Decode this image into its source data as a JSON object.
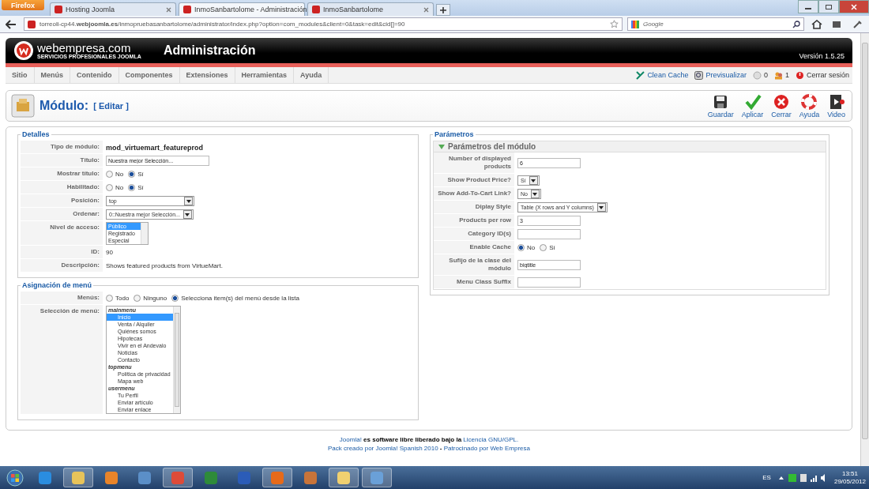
{
  "browser": {
    "menu_button": "Firefox",
    "tabs": [
      {
        "title": "Hosting Joomla",
        "selected": false
      },
      {
        "title": "InmoSanbartolome - Administración",
        "selected": true
      },
      {
        "title": "InmoSanbartolome",
        "selected": false
      }
    ],
    "url": "torreoli-cp44.**webjoomla.es**/inmopruebasanbartolome/administrator/index.php?option=com_modules&client=0&task=edit&cid[]=90",
    "search_placeholder": "Google"
  },
  "header": {
    "logo": "webempresa.com",
    "tagline": "SERVICIOS PROFESIONALES JOOMLA",
    "title": "Administración",
    "version": "Versión 1.5.25"
  },
  "menu": {
    "items": [
      "Sitio",
      "Menús",
      "Contenido",
      "Componentes",
      "Extensiones",
      "Herramientas",
      "Ayuda"
    ],
    "status": [
      {
        "kind": "cache",
        "label": "Clean Cache"
      },
      {
        "kind": "preview",
        "label": "Previsualizar"
      },
      {
        "kind": "messages",
        "label": "0"
      },
      {
        "kind": "users",
        "label": "1"
      },
      {
        "kind": "logout",
        "label": "Cerrar sesión"
      }
    ]
  },
  "toolbar": {
    "title": "Módulo:",
    "subtitle": "[ Editar ]",
    "buttons": [
      {
        "kind": "save",
        "label": "Guardar"
      },
      {
        "kind": "apply",
        "label": "Aplicar"
      },
      {
        "kind": "close",
        "label": "Cerrar"
      },
      {
        "kind": "help",
        "label": "Ayuda"
      },
      {
        "kind": "video",
        "label": "Video"
      }
    ]
  },
  "details": {
    "legend": "Detalles",
    "rows": [
      {
        "label": "Tipo de módulo:",
        "kind": "strong",
        "value": "mod_virtuemart_featureprod"
      },
      {
        "label": "Título:",
        "kind": "input",
        "value": "Nuestra mejor Selección..."
      },
      {
        "label": "Mostrar título:",
        "kind": "radio",
        "options": [
          {
            "label": "No",
            "selected": false
          },
          {
            "label": "Sí",
            "selected": true
          }
        ]
      },
      {
        "label": "Habilitado:",
        "kind": "radio",
        "options": [
          {
            "label": "No",
            "selected": false
          },
          {
            "label": "Sí",
            "selected": true
          }
        ]
      },
      {
        "label": "Posición:",
        "kind": "select",
        "value": "top"
      },
      {
        "label": "Ordenar:",
        "kind": "select",
        "value": "0::Nuestra mejor Selección..."
      },
      {
        "label": "Nivel de acceso:",
        "kind": "listbox",
        "options": [
          {
            "label": "Público",
            "selected": true
          },
          {
            "label": "Registrado",
            "selected": false
          },
          {
            "label": "Especial",
            "selected": false
          }
        ]
      },
      {
        "label": "ID:",
        "kind": "text",
        "value": "90"
      },
      {
        "label": "Descripción:",
        "kind": "text",
        "value": "Shows featured products from VirtueMart."
      }
    ]
  },
  "assignment": {
    "legend": "Asignación de menú",
    "rows": [
      {
        "label": "Menús:",
        "kind": "radio",
        "options": [
          {
            "label": "Todo",
            "selected": false
          },
          {
            "label": "Ninguno",
            "selected": false
          },
          {
            "label": "Selecciona item(s) del menú desde la lista",
            "selected": true
          }
        ]
      },
      {
        "label": "Selección de menú:",
        "kind": "tree",
        "groups": [
          {
            "label": "mainmenu",
            "children": [
              {
                "label": "Inicio",
                "selected": true
              },
              {
                "label": "Venta / Alquiler",
                "selected": false
              },
              {
                "label": "Quiénes somos",
                "selected": false
              },
              {
                "label": "Hipotecas",
                "selected": false
              },
              {
                "label": "Vivir en el Andevalo",
                "selected": false
              },
              {
                "label": "Noticias",
                "selected": false
              },
              {
                "label": "Contacto",
                "selected": false
              }
            ]
          },
          {
            "label": "topmenu",
            "children": [
              {
                "label": "Política de privacidad",
                "selected": false
              },
              {
                "label": "Mapa web",
                "selected": false
              }
            ]
          },
          {
            "label": "usermenu",
            "children": [
              {
                "label": "Tu Perfil",
                "selected": false
              },
              {
                "label": "Enviar artículo",
                "selected": false
              },
              {
                "label": "Enviar enlace",
                "selected": false
              }
            ]
          }
        ]
      }
    ]
  },
  "params": {
    "legend": "Parámetros",
    "panel": {
      "title": "Parámetros del módulo",
      "expanded": true
    },
    "rows": [
      {
        "label": "Number of displayed products",
        "kind": "input",
        "value": "6"
      },
      {
        "label": "Show Product Price?",
        "kind": "select",
        "value": "Sí"
      },
      {
        "label": "Show Add-To-Cart Link?",
        "kind": "select",
        "value": "No"
      },
      {
        "label": "Diplay Style",
        "kind": "select",
        "value": "Table (X rows and Y columns)"
      },
      {
        "label": "Products per row",
        "kind": "input",
        "value": "3"
      },
      {
        "label": "Category ID(s)",
        "kind": "input"
      },
      {
        "label": "Enable Cache",
        "kind": "radio",
        "options": [
          {
            "label": "No",
            "selected": true
          },
          {
            "label": "Sí",
            "selected": false
          }
        ]
      },
      {
        "label": "Sufijo de la clase del módulo",
        "kind": "input",
        "value": "bigtitle"
      },
      {
        "label": "Menu Class Suffix",
        "kind": "input"
      }
    ]
  },
  "footer": {
    "lines": [
      {
        "segments": [
          {
            "text": "Joomla!",
            "link": true
          },
          {
            "text": " es software libre liberado bajo la ",
            "link": false
          },
          {
            "text": "Licencia GNU/GPL.",
            "link": true
          }
        ]
      },
      {
        "segments": [
          {
            "text": "Pack creado por Joomla! Spanish 2010",
            "link": true
          },
          {
            "text": " - ",
            "link": false
          },
          {
            "text": "Patrocinado por Web Empresa",
            "link": true
          }
        ]
      }
    ]
  },
  "taskbar": {
    "apps": [
      {
        "kind": "ie",
        "running": false
      },
      {
        "kind": "explorer",
        "running": true
      },
      {
        "kind": "media",
        "running": false
      },
      {
        "kind": "network",
        "running": false
      },
      {
        "kind": "chrome",
        "running": true
      },
      {
        "kind": "excel",
        "running": false
      },
      {
        "kind": "word",
        "running": false
      },
      {
        "kind": "firefox",
        "running": true
      },
      {
        "kind": "tool",
        "running": false
      },
      {
        "kind": "folder",
        "running": true
      },
      {
        "kind": "paint",
        "running": true
      }
    ],
    "language": "ES",
    "time": "13:51",
    "date": "29/05/2012"
  }
}
